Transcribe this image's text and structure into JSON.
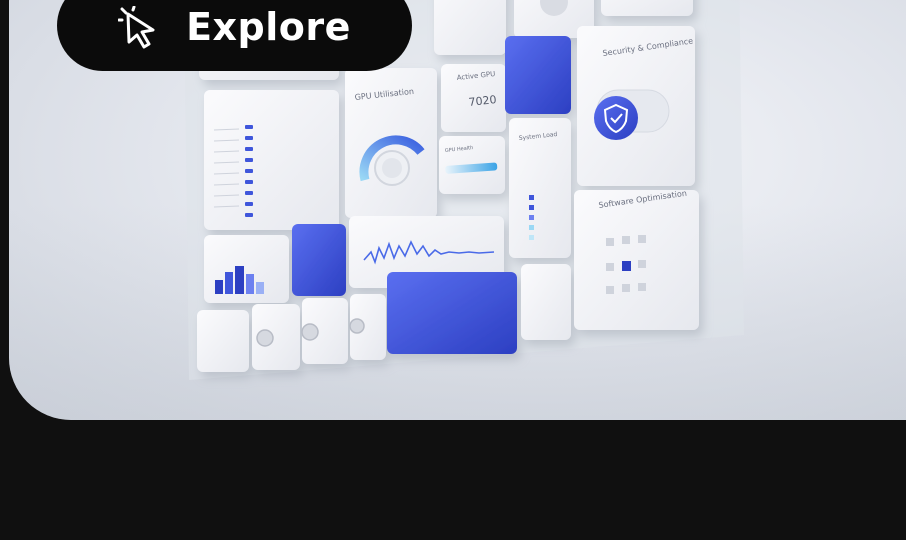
{
  "hero": {
    "cta": {
      "label": "Explore",
      "icon": "cursor-click-icon"
    },
    "illustration": {
      "tiles": {
        "gpu_utilisation": "GPU Utilisation",
        "active_gpu": "Active GPU",
        "active_gpu_value": "7020",
        "gpu_health": "GPU Health",
        "system_load": "System Load",
        "security": "Security & Compliance",
        "software": "Software Optimisation"
      },
      "colors": {
        "accent": "#3a4fd6",
        "accent_light": "#6c80f0",
        "tile": "#f3f4f7",
        "page_background": "#101010"
      }
    }
  }
}
